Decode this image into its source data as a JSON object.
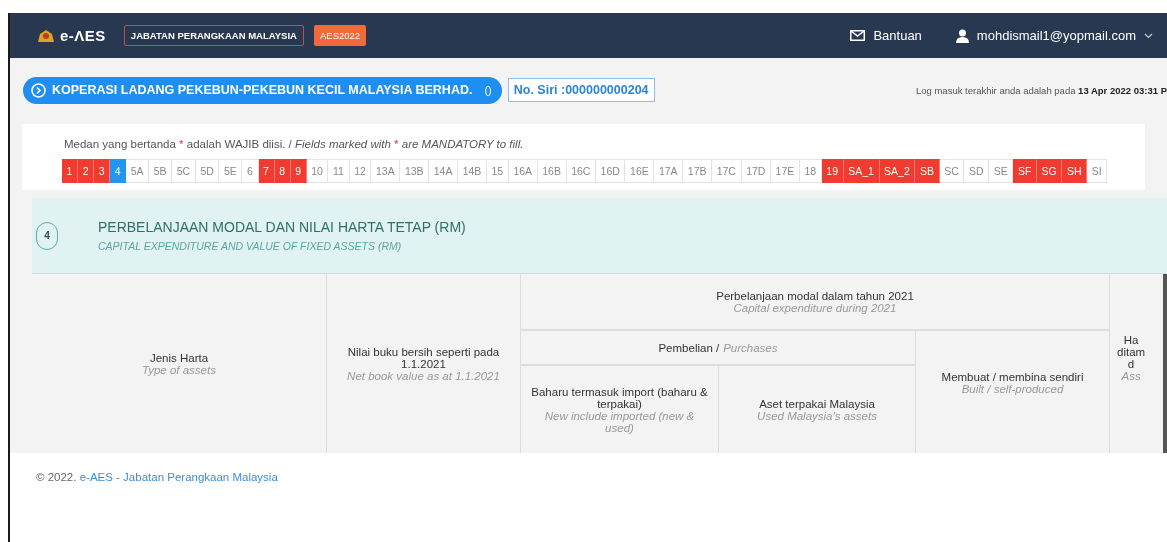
{
  "header": {
    "logo": "e-ΛES",
    "agency": "JABATAN PERANGKAAN MALAYSIA",
    "badge": "AES2022",
    "help": "Bantuan",
    "user": "mohdismail1@yopmail.com"
  },
  "company": {
    "name": "KOPERASI LADANG PEKEBUN-PEKEBUN KECIL MALAYSIA BERHAD.",
    "suffix": "()",
    "serial": "No. Siri :000000000204"
  },
  "last_login": "Log masuk terakhir anda adalah pada **13 Apr 2022 03:31 P**",
  "notice": [
    {
      "text": "Medan yang bertanda ",
      "kind": "plain"
    },
    {
      "text": "*",
      "kind": "required"
    },
    {
      "text": " adalah WAJIB diisi. / ",
      "kind": "plain"
    },
    {
      "text": "Fields marked with ",
      "kind": "english"
    },
    {
      "text": "*",
      "kind": "required"
    },
    {
      "text": " are MANDATORY to fill.",
      "kind": "english"
    }
  ],
  "sections": [
    {
      "label": "1",
      "selected": false,
      "error": true
    },
    {
      "label": "2",
      "selected": false,
      "error": true
    },
    {
      "label": "3",
      "selected": false,
      "error": true
    },
    {
      "label": "4",
      "selected": true,
      "error": false
    },
    {
      "label": "5A",
      "selected": false,
      "error": false
    },
    {
      "label": "5B",
      "selected": false,
      "error": false
    },
    {
      "label": "5C",
      "selected": false,
      "error": false
    },
    {
      "label": "5D",
      "selected": false,
      "error": false
    },
    {
      "label": "5E",
      "selected": false,
      "error": false
    },
    {
      "label": "6",
      "selected": false,
      "error": false
    },
    {
      "label": "7",
      "selected": false,
      "error": true
    },
    {
      "label": "8",
      "selected": false,
      "error": true
    },
    {
      "label": "9",
      "selected": false,
      "error": true
    },
    {
      "label": "10",
      "selected": false,
      "error": false
    },
    {
      "label": "11",
      "selected": false,
      "error": false
    },
    {
      "label": "12",
      "selected": false,
      "error": false
    },
    {
      "label": "13A",
      "selected": false,
      "error": false
    },
    {
      "label": "13B",
      "selected": false,
      "error": false
    },
    {
      "label": "14A",
      "selected": false,
      "error": false
    },
    {
      "label": "14B",
      "selected": false,
      "error": false
    },
    {
      "label": "15",
      "selected": false,
      "error": false
    },
    {
      "label": "16A",
      "selected": false,
      "error": false
    },
    {
      "label": "16B",
      "selected": false,
      "error": false
    },
    {
      "label": "16C",
      "selected": false,
      "error": false
    },
    {
      "label": "16D",
      "selected": false,
      "error": false
    },
    {
      "label": "16E",
      "selected": false,
      "error": false
    },
    {
      "label": "17A",
      "selected": false,
      "error": false
    },
    {
      "label": "17B",
      "selected": false,
      "error": false
    },
    {
      "label": "17C",
      "selected": false,
      "error": false
    },
    {
      "label": "17D",
      "selected": false,
      "error": false
    },
    {
      "label": "17E",
      "selected": false,
      "error": false
    },
    {
      "label": "18",
      "selected": false,
      "error": false
    },
    {
      "label": "19",
      "selected": false,
      "error": true
    },
    {
      "label": "SA_1",
      "selected": false,
      "error": true
    },
    {
      "label": "SA_2",
      "selected": false,
      "error": true
    },
    {
      "label": "SB",
      "selected": false,
      "error": true
    },
    {
      "label": "SC",
      "selected": false,
      "error": false
    },
    {
      "label": "SD",
      "selected": false,
      "error": false
    },
    {
      "label": "SE",
      "selected": false,
      "error": false
    },
    {
      "label": "SF",
      "selected": false,
      "error": true
    },
    {
      "label": "SG",
      "selected": false,
      "error": true
    },
    {
      "label": "SH",
      "selected": false,
      "error": true
    },
    {
      "label": "SI",
      "selected": false,
      "error": false
    }
  ],
  "section": {
    "number": "4",
    "title": "PERBELANJAAN MODAL DAN NILAI HARTA TETAP (RM)",
    "subtitle": "CAPITAL EXPENDITURE AND VALUE OF FIXED ASSETS (RM)"
  },
  "table": {
    "asset_type": {
      "label": "Jenis Harta",
      "sublabel": "Type of assets"
    },
    "net_book_value": {
      "label": "Nilai buku bersih seperti pada 1.1.2021",
      "sublabel": "Net book value as at 1.1.2021"
    },
    "capital_expenditure": {
      "label": "Perbelanjaan modal dalam tahun 2021",
      "sublabel": "Capital expenditure during 2021"
    },
    "purchases": {
      "label": "Pembelian /",
      "sublabel": "Purchases"
    },
    "new_imported": {
      "label": "Baharu termasuk import (baharu & terpakai)",
      "sublabel": "New include imported (new & used)"
    },
    "used_malaysia": {
      "label": "Aset terpakai Malaysia",
      "sublabel": "Used Malaysia's assets"
    },
    "self_built": {
      "label": "Membuat / membina sendiri",
      "sublabel": "Built / self-produced"
    },
    "column_8": {
      "lines": [
        "Ha",
        "ditam",
        "d"
      ],
      "sublabel": "Ass"
    }
  },
  "footer": {
    "copyright": "© 2022.",
    "link": "e-AES - Jabatan Perangkaan Malaysia"
  }
}
